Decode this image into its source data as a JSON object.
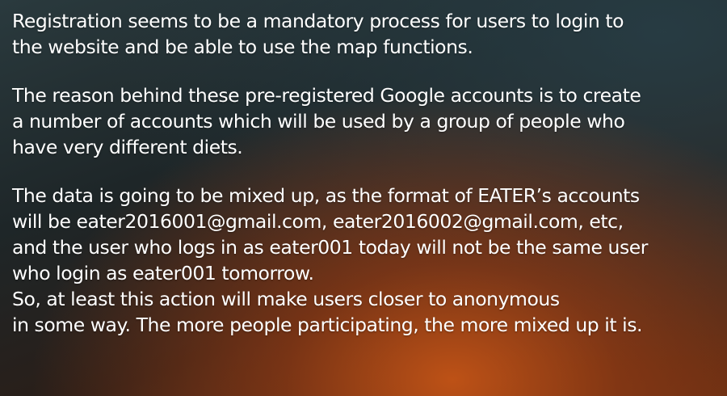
{
  "slide": {
    "paragraph_1": {
      "lines": [
        "Registration seems to be a mandatory process for users to login to",
        "the website and be able to use the map functions."
      ]
    },
    "paragraph_2": {
      "lines": [
        "The reason behind these pre-registered Google accounts is to create",
        "a number of accounts which will be used by a group of people who",
        "have very different diets."
      ]
    },
    "paragraph_3": {
      "lines": [
        "The data is going to be mixed up, as the format of EATER’s accounts",
        "will be eater2016001@gmail.com, eater2016002@gmail.com, etc,",
        "and the user who logs in as eater001 today will not be the same user",
        "who login as eater001 tomorrow.",
        "So, at least this action will make users closer to anonymous",
        "in some way. The more people participating, the more mixed up it is."
      ]
    }
  }
}
